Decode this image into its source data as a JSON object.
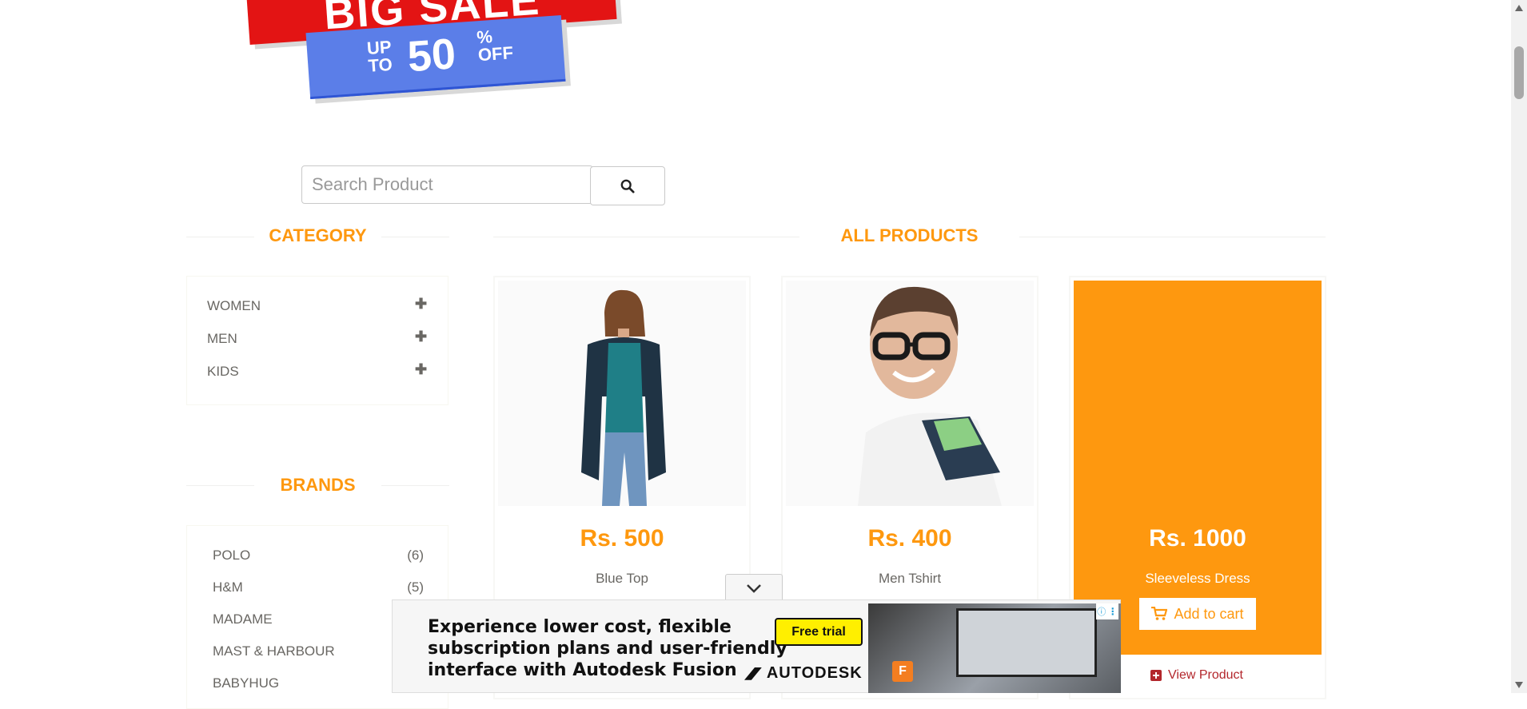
{
  "banner": {
    "line1": "BIG SALE",
    "up": "UP",
    "to": "TO",
    "amount": "50",
    "percent": "%",
    "off": "OFF"
  },
  "search": {
    "placeholder": "Search Product",
    "button_icon": "search-icon"
  },
  "category": {
    "heading": "CATEGORY",
    "items": [
      {
        "label": "WOMEN",
        "icon": "plus-icon"
      },
      {
        "label": "MEN",
        "icon": "plus-icon"
      },
      {
        "label": "KIDS",
        "icon": "plus-icon"
      }
    ]
  },
  "brands": {
    "heading": "BRANDS",
    "items": [
      {
        "label": "POLO",
        "count": "(6)"
      },
      {
        "label": "H&M",
        "count": "(5)"
      },
      {
        "label": "MADAME",
        "count": ""
      },
      {
        "label": "MAST & HARBOUR",
        "count": ""
      },
      {
        "label": "BABYHUG",
        "count": ""
      }
    ]
  },
  "products": {
    "heading": "ALL PRODUCTS",
    "items": [
      {
        "price": "Rs. 500",
        "name": "Blue Top"
      },
      {
        "price": "Rs. 400",
        "name": "Men Tshirt"
      },
      {
        "price": "Rs. 1000",
        "name": "Sleeveless Dress",
        "cart_label": "Add to cart",
        "view_label": "View Product"
      }
    ]
  },
  "ad": {
    "text_lines": [
      "Experience lower cost, flexible",
      "subscription plans and user-friendly",
      "interface with Autodesk Fusion"
    ],
    "cta": "Free trial",
    "brand": "AUTODESK"
  },
  "colors": {
    "accent": "#fe980f",
    "text": "#696763",
    "link": "#b3272c"
  }
}
